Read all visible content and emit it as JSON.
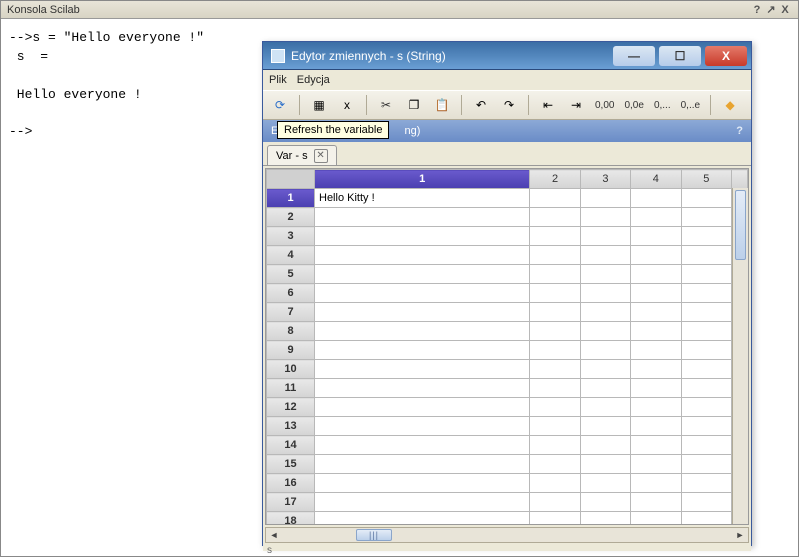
{
  "console": {
    "title": "Konsola Scilab",
    "ctrl_help": "?",
    "ctrl_undock": "↗",
    "ctrl_close": "X",
    "line1": "-->s = \"Hello everyone !\"",
    "line2": " s  =",
    "line3": " ",
    "line4": " Hello everyone !",
    "line5": " ",
    "line6": "-->"
  },
  "editor": {
    "title": "Edytor zmiennych - s  (String)",
    "btn_min": "—",
    "btn_max": "☐",
    "btn_close": "X",
    "menubar": {
      "file": "Plik",
      "edit": "Edycja"
    },
    "toolbar": {
      "refresh": "⟳",
      "doc1": "▦",
      "doc2": "x",
      "cut": "✂",
      "copy": "❐",
      "paste": "📋",
      "undo": "↶",
      "redo": "↷",
      "short_open": "⇤",
      "short_close": "⇥",
      "fmt1": "0,00",
      "fmt2": "0,0e",
      "fmt3": "0,...",
      "fmt4": "0,..e",
      "diamond": "◆"
    },
    "pathbar": {
      "text_hidden_prefix": "Ed",
      "text_hidden_suffix": "ng)",
      "help": "?"
    },
    "tooltip": "Refresh the variable",
    "tab": {
      "label": "Var - s",
      "close": "✕"
    },
    "grid": {
      "col_headers": [
        "1",
        "2",
        "3",
        "4",
        "5"
      ],
      "row_headers": [
        "1",
        "2",
        "3",
        "4",
        "5",
        "6",
        "7",
        "8",
        "9",
        "10",
        "11",
        "12",
        "13",
        "14",
        "15",
        "16",
        "17",
        "18"
      ],
      "selected_col": 1,
      "selected_row": 1,
      "cells": {
        "r1c1": "Hello Kitty !"
      }
    },
    "hscroll_thumb": "|||",
    "footer": "s"
  }
}
